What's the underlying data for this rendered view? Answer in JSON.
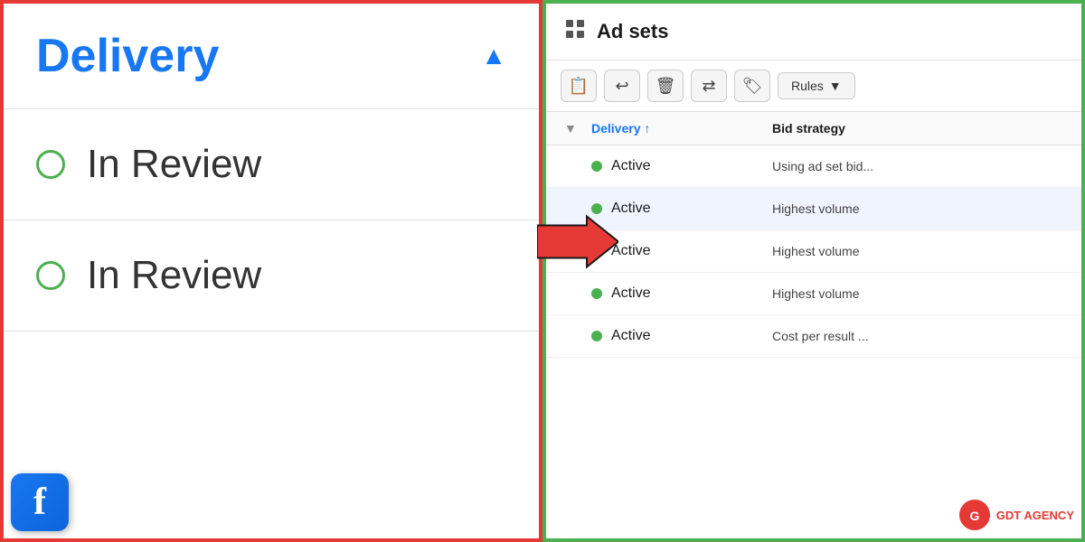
{
  "leftPanel": {
    "title": "Delivery",
    "rows": [
      {
        "label": "In Review"
      },
      {
        "label": "In Review"
      }
    ]
  },
  "rightPanel": {
    "title": "Ad sets",
    "toolbar": {
      "buttons": [
        "clipboard",
        "undo",
        "trash",
        "export",
        "tag"
      ],
      "rulesLabel": "Rules"
    },
    "table": {
      "columns": [
        {
          "label": ""
        },
        {
          "label": "Delivery ↑"
        },
        {
          "label": "Bid strategy"
        }
      ],
      "rows": [
        {
          "delivery": "Active",
          "bid": "Using ad set bid...",
          "highlighted": false
        },
        {
          "delivery": "Active",
          "bid": "Highest volume",
          "highlighted": true
        },
        {
          "delivery": "Active",
          "bid": "Highest volume",
          "highlighted": false
        },
        {
          "delivery": "Active",
          "bid": "Highest volume",
          "highlighted": false
        },
        {
          "delivery": "Active",
          "bid": "Cost per result ...",
          "highlighted": false
        }
      ]
    }
  },
  "watermark": {
    "text": "GDT AGENCY"
  }
}
